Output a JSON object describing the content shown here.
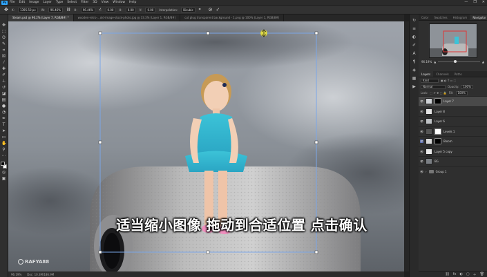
{
  "app": {
    "logo": "Ps"
  },
  "menu": [
    "File",
    "Edit",
    "Image",
    "Layer",
    "Type",
    "Select",
    "Filter",
    "3D",
    "View",
    "Window",
    "Help"
  ],
  "window_controls": [
    "—",
    "❐",
    "✕"
  ],
  "options": {
    "x_label": "X:",
    "x_value": "1395.50 px",
    "w_label": "W:",
    "w_value": "96.46%",
    "h_label": "H:",
    "h_value": "96.46%",
    "angle_value": "0.00",
    "hskew_label": "H:",
    "hskew_value": "0.00",
    "vskew_label": "V:",
    "vskew_value": "0.00",
    "interp_label": "Interpolation:",
    "interp_value": "Bicubic",
    "cancel_symbol": "⊘",
    "commit_symbol": "✓"
  },
  "doc_tabs": [
    {
      "label": "Steam.psd @ 96.2% (Layer 7, RGB/8#) *"
    },
    {
      "label": "wooden-retro-...old-image-stock-photo.jpg @ 33.3% (Layer 1, RGB/8#)"
    },
    {
      "label": "cut plug transparent background - 1.png @ 100% (Layer 1, RGB/8#)"
    }
  ],
  "caption": "适当缩小图像 拖动到合适位置 点击确认",
  "watermark": "RAFYA88",
  "status": {
    "zoom": "96.19%",
    "doc": "Doc: 10.3M/186.9M"
  },
  "panel": {
    "top_tabs": [
      "Color",
      "Swatches",
      "Histogram",
      "Navigator"
    ],
    "active_top_tab": "Navigator",
    "nav_zoom": "96.19%",
    "layer_tabs": [
      "Layers",
      "Channels",
      "Paths"
    ],
    "active_layer_tab": "Layers",
    "search_placeholder": "Kind",
    "blend_mode": "Normal",
    "opacity_label": "Opacity:",
    "opacity_value": "100%",
    "lock_label": "Lock:",
    "fill_label": "Fill:",
    "fill_value": "100%",
    "layers": [
      {
        "name": "Layer 7",
        "selected": true,
        "mask": true
      },
      {
        "name": "Layer 8"
      },
      {
        "name": "Layer 6"
      },
      {
        "name": "Levels 1",
        "mask": true
      },
      {
        "name": "Bloom",
        "mask": true
      },
      {
        "name": "Layer 5 copy"
      },
      {
        "name": "BG"
      },
      {
        "name": "Group 1",
        "folder": true
      }
    ],
    "bottom_icons": [
      "fx",
      "◐",
      "▢",
      "＋",
      "🗑"
    ]
  }
}
